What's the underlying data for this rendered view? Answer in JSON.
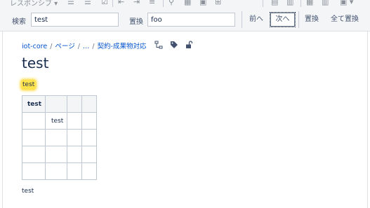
{
  "toolbar": {
    "paragraph_style": "レスポンシブ"
  },
  "find_replace": {
    "search_label": "検索",
    "search_value": "test",
    "replace_label": "置換",
    "replace_value": "foo",
    "prev_label": "前へ",
    "next_label": "次へ",
    "replace_button": "置換",
    "replace_all_button": "全て置換"
  },
  "breadcrumb": {
    "space": "iot-core",
    "pages": "ページ",
    "ellipsis": "…",
    "parent": "契約-成果物対応"
  },
  "page": {
    "title": "test",
    "highlighted_text": "test",
    "table": {
      "header": [
        "test",
        "",
        "",
        ""
      ],
      "rows": [
        [
          "",
          "test",
          "",
          ""
        ],
        [
          "",
          "",
          "",
          ""
        ],
        [
          "",
          "",
          "",
          ""
        ],
        [
          "",
          "",
          "",
          ""
        ]
      ]
    },
    "footer_text": "test"
  }
}
